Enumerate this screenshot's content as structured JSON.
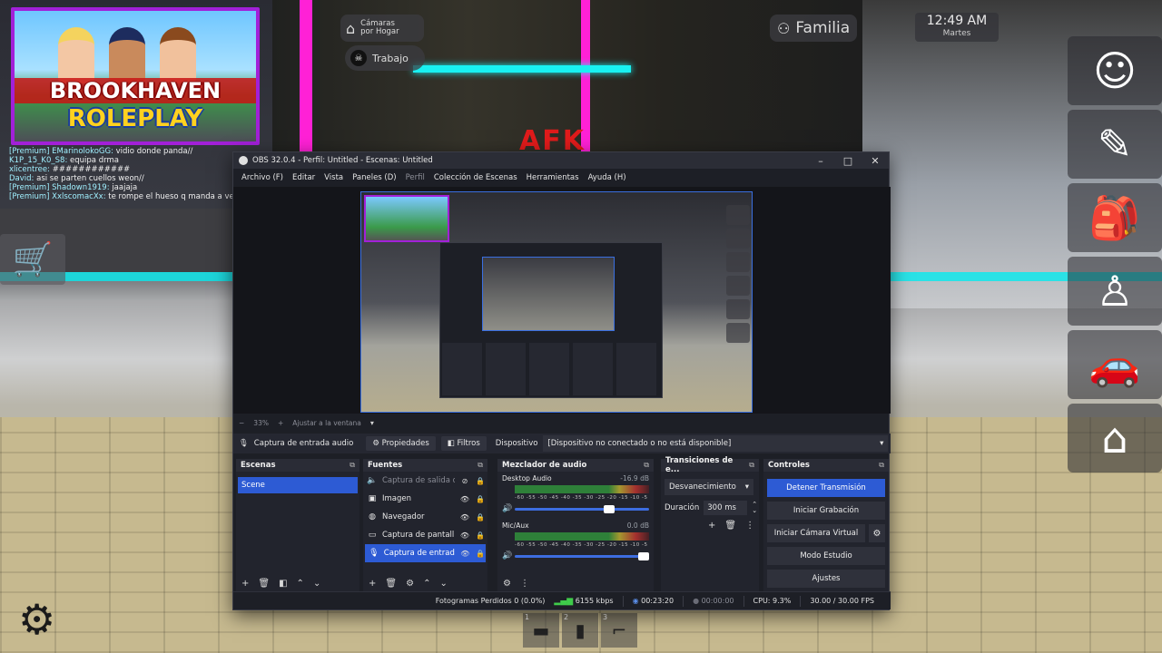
{
  "game": {
    "afk_label": "AFK",
    "thumbnail": {
      "title_line1": "BROOKHAVEN",
      "title_line2": "ROLEPLAY"
    },
    "hud": {
      "home_button": "Cámaras\npor Hogar",
      "home_line1": "Cámaras",
      "home_line2": "por Hogar",
      "work_button": "Trabajo",
      "family_button": "Familia",
      "clock_time": "12:49 AM",
      "clock_day": "Martes"
    },
    "chat": [
      {
        "name": "[Premium] EMarinolokoGG:",
        "text": "vidio donde panda//"
      },
      {
        "name": "K1P_15_K0_S8:",
        "text": "equipa drma"
      },
      {
        "name": "xlicentree:",
        "text": "############"
      },
      {
        "name": "David:",
        "text": "asi se parten cuellos weon//"
      },
      {
        "name": "[Premium] Shadown1919:",
        "text": "jaajaja"
      },
      {
        "name": "[Premium] XxlscomacXx:",
        "text": "te rompe el hueso q manda a verla"
      }
    ],
    "side_icons": [
      "face-icon",
      "face-pencil-icon",
      "backpack-icon",
      "avatar-icon",
      "car-icon",
      "house-icon"
    ],
    "hotbar": [
      {
        "slot": "1",
        "icon": "rifle-icon"
      },
      {
        "slot": "2",
        "icon": "phone-icon"
      },
      {
        "slot": "3",
        "icon": "pistol-icon"
      }
    ]
  },
  "obs": {
    "title": "OBS 32.0.4 - Perfil: Untitled - Escenas: Untitled",
    "menu": [
      "Archivo (F)",
      "Editar",
      "Vista",
      "Paneles (D)",
      "Perfil",
      "Colección de Escenas",
      "Herramientas",
      "Ayuda (H)"
    ],
    "zoom": {
      "percent": "33%",
      "fit_label": "Ajustar a la ventana"
    },
    "properties_bar": {
      "source_label": "Captura de entrada audio",
      "properties_button": "Propiedades",
      "filters_button": "Filtros",
      "device_label": "Dispositivo",
      "device_value": "[Dispositivo no conectado o no está disponible]"
    },
    "scenes": {
      "title": "Escenas",
      "items": [
        "Scene"
      ]
    },
    "sources": {
      "title": "Fuentes",
      "items": [
        {
          "name": "Captura de salida d",
          "icon": "speaker-icon",
          "visible": false
        },
        {
          "name": "Imagen",
          "icon": "image-icon",
          "visible": true
        },
        {
          "name": "Navegador",
          "icon": "globe-icon",
          "visible": true
        },
        {
          "name": "Captura de pantall",
          "icon": "monitor-icon",
          "visible": true
        },
        {
          "name": "Captura de entrad",
          "icon": "mic-icon",
          "visible": true
        }
      ]
    },
    "mixer": {
      "title": "Mezclador de audio",
      "ticks": "-60 -55 -50 -45 -40 -35 -30 -25 -20 -15 -10 -5 0",
      "channels": [
        {
          "name": "Desktop Audio",
          "db": "-16.9 dB",
          "volume": 0.74
        },
        {
          "name": "Mic/Aux",
          "db": "0.0 dB",
          "volume": 1.0
        }
      ]
    },
    "transitions": {
      "title": "Transiciones de e...",
      "selected": "Desvanecimiento",
      "duration_label": "Duración",
      "duration_value": "300 ms"
    },
    "controls": {
      "title": "Controles",
      "stop_stream": "Detener Transmisión",
      "start_recording": "Iniciar Grabación",
      "start_virtual_cam": "Iniciar Cámara Virtual",
      "studio_mode": "Modo Estudio",
      "settings": "Ajustes"
    },
    "status": {
      "dropped_frames": "Fotogramas Perdidos 0 (0.0%)",
      "bitrate": "6155 kbps",
      "stream_time": "00:23:20",
      "record_time": "00:00:00",
      "cpu": "CPU: 9.3%",
      "fps": "30.00 / 30.00 FPS"
    }
  },
  "colors": {
    "accent": "#2d5bd4",
    "neon_magenta": "#ff21d6",
    "neon_cyan": "#19f1f2",
    "thumb_border": "#a220d8"
  }
}
